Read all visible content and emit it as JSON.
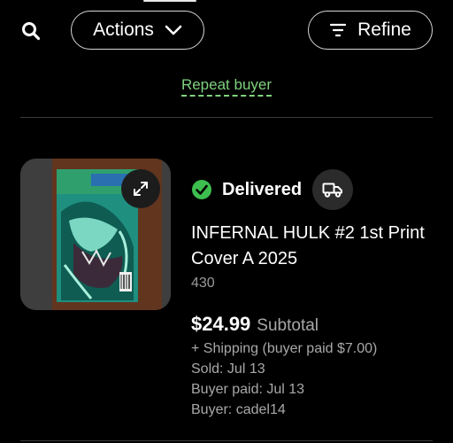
{
  "toolbar": {
    "search_icon": "search-icon",
    "actions_label": "Actions",
    "refine_label": "Refine"
  },
  "banner": {
    "repeat_buyer": "Repeat buyer"
  },
  "order": {
    "status": "Delivered",
    "status_color": "#3dbe4f",
    "title": "INFERNAL HULK #2 1st Print Cover A 2025",
    "quantity": "430",
    "price": "$24.99",
    "price_label": "Subtotal",
    "shipping": "+ Shipping (buyer paid $7.00)",
    "sold": "Sold: Jul 13",
    "buyer_paid": "Buyer paid: Jul 13",
    "buyer": "Buyer: cadel14"
  },
  "colors": {
    "background": "#000000",
    "accent_green": "#7fd27f",
    "muted_text": "#a8a8a8"
  }
}
